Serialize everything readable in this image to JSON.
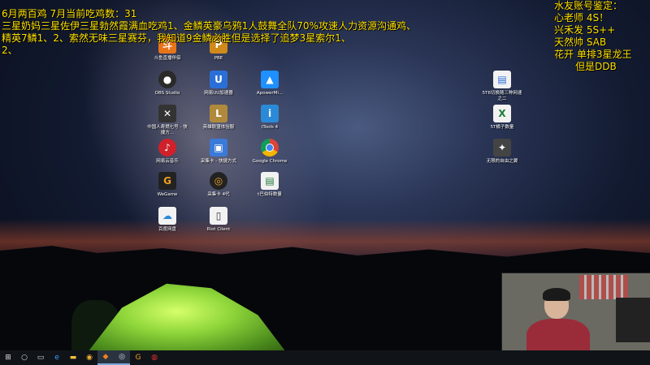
{
  "overlay_left": {
    "line1": "6月两百鸡 7月当前吃鸡数：31",
    "line2": "三星奶妈三星佐伊三星勃然霞满血吃鸡1、金鳞英豪乌鸦1人鼓舞全队70%攻速人力资源沟通鸡、",
    "line3": "精英7鳞1、2、索然无味三星赛芬，我知道9金鳞必胜但是选择了追梦3星索尔1、",
    "line4": "2、"
  },
  "overlay_right": {
    "line1": "水友账号鉴定：",
    "line2": "心老师 4S！",
    "line3": "兴禾发 5S++",
    "line4": "天然帅 SAB",
    "line5": "花开 单排3星龙王",
    "line6": "但是DDB"
  },
  "desktop_icons": [
    {
      "label": "斗鱼直播伴侣",
      "icon": "app-icon",
      "color": "#e8741a"
    },
    {
      "label": "PBE",
      "icon": "app-icon",
      "color": "#d08a1a"
    },
    {
      "label": "OBS Studio",
      "icon": "obs-icon",
      "color": "#2a2a2a"
    },
    {
      "label": "网易UU加速器",
      "icon": "app-icon",
      "color": "#2a6fd8"
    },
    {
      "label": "ApowerMi...",
      "icon": "app-icon",
      "color": "#1e90ff"
    },
    {
      "label": "中国人寿燃七号 - 快捷方...",
      "icon": "app-icon",
      "color": "#333"
    },
    {
      "label": "英雄联盟体验服",
      "icon": "lol-icon",
      "color": "#b08a3a"
    },
    {
      "label": "iTools 4",
      "icon": "app-icon",
      "color": "#2a8ad8"
    },
    {
      "label": "网易云音乐",
      "icon": "netease-music-icon",
      "color": "#d0212a"
    },
    {
      "label": "采集卡 - 快捷方式",
      "icon": "app-icon",
      "color": "#3a7ad8"
    },
    {
      "label": "Google Chrome",
      "icon": "chrome-icon",
      "color": "#e8e8e8"
    },
    {
      "label": "WeGame",
      "icon": "wegame-icon",
      "color": "#222"
    },
    {
      "label": "采集卡 4代",
      "icon": "app-icon",
      "color": "#222"
    },
    {
      "label": "t巴伯特数量",
      "icon": "doc-icon",
      "color": "#f2f2f2"
    },
    {
      "label": "百度网盘",
      "icon": "baidu-pan-icon",
      "color": "#f2f2f2"
    },
    {
      "label": "Riot Client",
      "icon": "riot-icon",
      "color": "#f2f2f2"
    },
    {
      "label": "5T6切换随三种网速之二",
      "icon": "doc-icon",
      "color": "#f2f2f2"
    },
    {
      "label": "5T橘子数量",
      "icon": "excel-icon",
      "color": "#1e7a3a"
    },
    {
      "label": "无限的自由之翼",
      "icon": "app-icon",
      "color": "#444"
    }
  ],
  "taskbar": [
    {
      "name": "start-icon",
      "glyph": "⊞"
    },
    {
      "name": "search-icon",
      "glyph": "○"
    },
    {
      "name": "task-view-icon",
      "glyph": "▭"
    },
    {
      "name": "edge-icon",
      "glyph": "e"
    },
    {
      "name": "explorer-icon",
      "glyph": "▬"
    },
    {
      "name": "chrome-icon",
      "glyph": "◉"
    },
    {
      "name": "douyu-icon",
      "glyph": "◆"
    },
    {
      "name": "obs-icon",
      "glyph": "◎"
    },
    {
      "name": "wegame-icon",
      "glyph": "G"
    },
    {
      "name": "netease-music-icon",
      "glyph": "◍"
    }
  ]
}
